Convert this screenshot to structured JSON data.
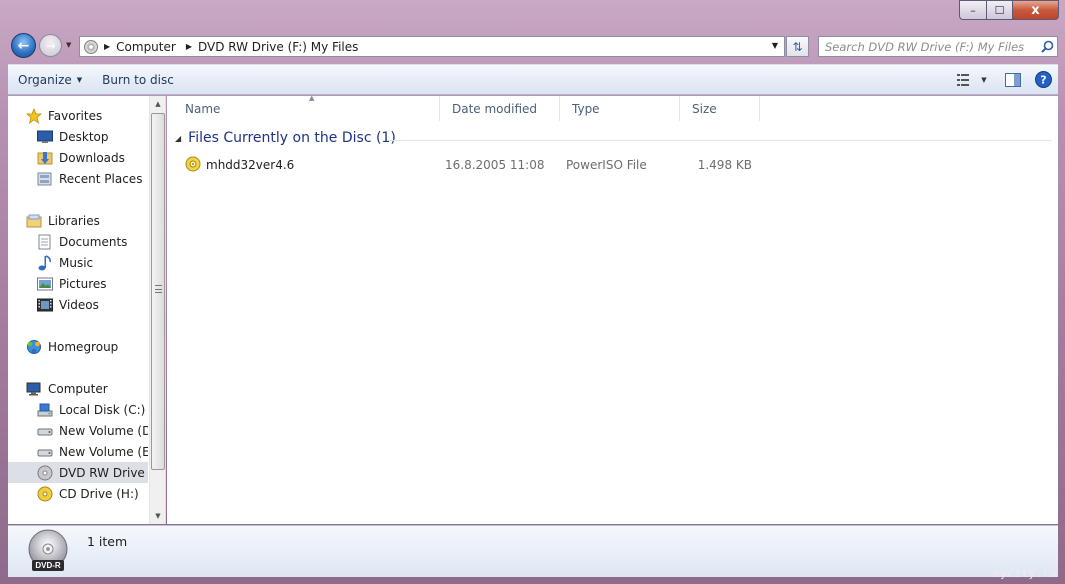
{
  "window": {
    "caption_buttons": {
      "minimize": "–",
      "maximize": "☐",
      "close": "x"
    }
  },
  "address_bar": {
    "breadcrumbs": [
      "Computer",
      "DVD RW Drive (F:) My Files"
    ]
  },
  "search": {
    "placeholder": "Search DVD RW Drive (F:) My Files"
  },
  "toolbar": {
    "organize_label": "Organize",
    "burn_label": "Burn to disc"
  },
  "navigation_pane": {
    "favorites": {
      "label": "Favorites",
      "items": [
        "Desktop",
        "Downloads",
        "Recent Places"
      ]
    },
    "libraries": {
      "label": "Libraries",
      "items": [
        "Documents",
        "Music",
        "Pictures",
        "Videos"
      ]
    },
    "homegroup": {
      "label": "Homegroup"
    },
    "computer": {
      "label": "Computer",
      "items": [
        "Local Disk (C:)",
        "New Volume (D:)",
        "New Volume (E:)",
        "DVD RW Drive (F:)",
        "CD Drive (H:)"
      ],
      "selected": "DVD RW Drive (F:)"
    }
  },
  "columns": [
    "Name",
    "Date modified",
    "Type",
    "Size"
  ],
  "group": {
    "title": "Files Currently on the Disc (1)"
  },
  "files": [
    {
      "name": "mhdd32ver4.6",
      "date_modified": "16.8.2005 11:08",
      "type": "PowerISO File",
      "size": "1.498 KB"
    }
  ],
  "details_pane": {
    "disc_label": "DVD-R",
    "item_count": "1 item"
  },
  "watermark": "mycity.rs",
  "colors": {
    "accent": "#1e3287",
    "selection": "#dcdfe6",
    "toolbar_text": "#1e395b"
  }
}
